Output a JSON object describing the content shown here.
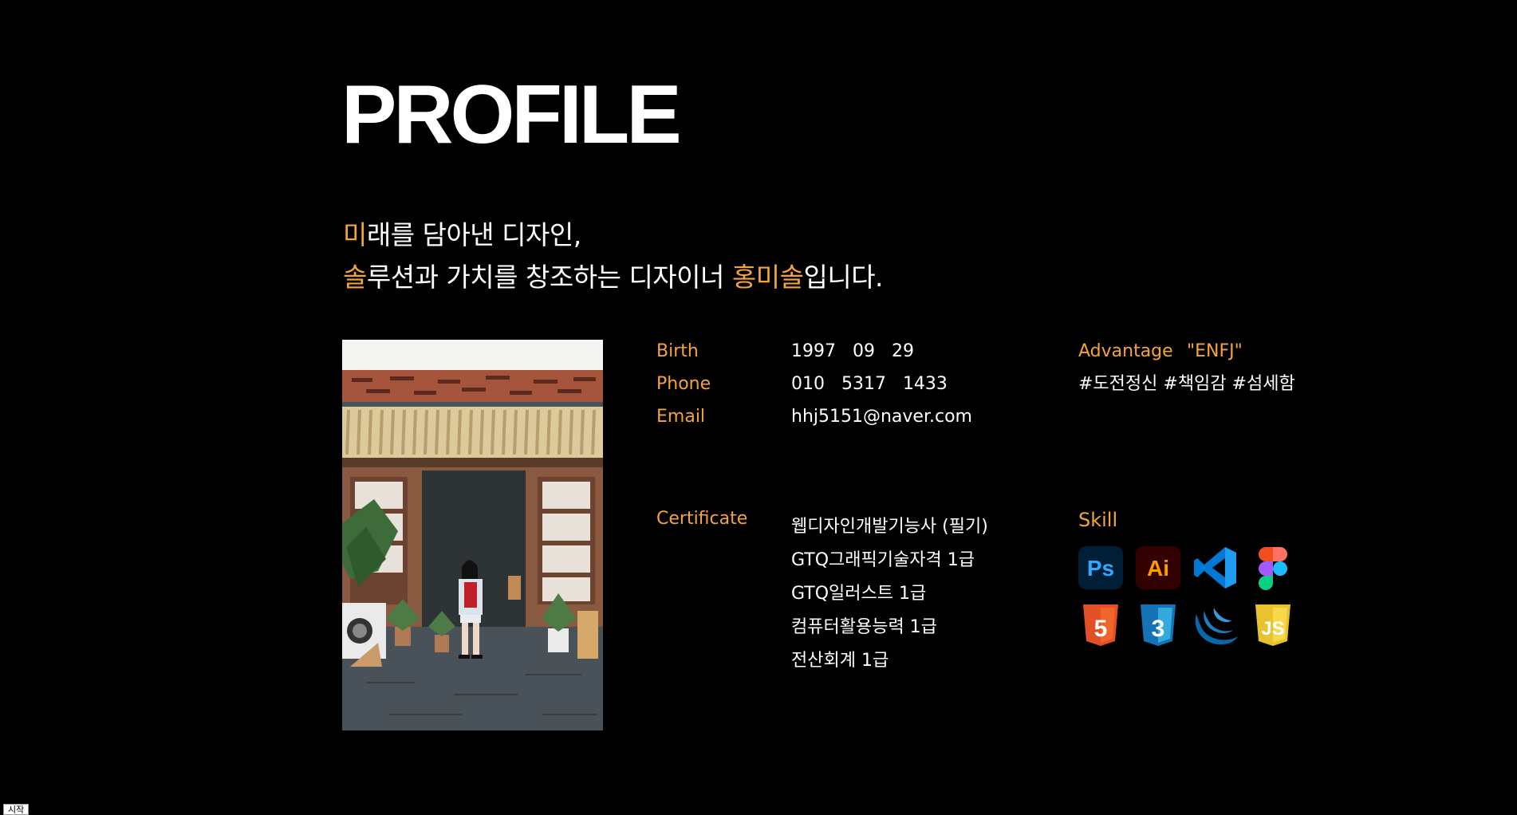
{
  "page": {
    "title": "PROFILE",
    "accent_color": "#f5a43c"
  },
  "intro": {
    "line1_accent": "미",
    "line1_rest": "래를 담아낸 디자인,",
    "line2_accent": "솔",
    "line2_mid": "루션과 가치를 창조하는 디자이너 ",
    "line2_name": "홍미솔",
    "line2_end": "입니다."
  },
  "info": {
    "birth_label": "Birth",
    "birth_value": "1997   09   29",
    "phone_label": "Phone",
    "phone_value": "010   5317   1433",
    "email_label": "Email",
    "email_value": "hhj5151@naver.com",
    "certificate_label": "Certificate"
  },
  "advantage": {
    "label": "Advantage",
    "mbti": "\"ENFJ\"",
    "tags": "#도전정신 #책임감 #섬세함"
  },
  "certificates": [
    "웹디자인개발기능사 (필기)",
    "GTQ그래픽기술자격 1급",
    "GTQ일러스트 1급",
    "컴퓨터활용능력 1급",
    "전산회계 1급"
  ],
  "skill": {
    "label": "Skill",
    "icons": [
      {
        "name": "photoshop-icon",
        "text": "Ps",
        "bg": "#001e36",
        "fg": "#31a8ff"
      },
      {
        "name": "illustrator-icon",
        "text": "Ai",
        "bg": "#330000",
        "fg": "#ff9a00"
      },
      {
        "name": "vscode-icon",
        "text": "",
        "bg": "",
        "fg": "#0078d4"
      },
      {
        "name": "figma-icon",
        "text": "",
        "bg": "",
        "fg": ""
      },
      {
        "name": "html5-icon",
        "text": "5",
        "bg": "#e34f26",
        "fg": "#ffffff"
      },
      {
        "name": "css3-icon",
        "text": "3",
        "bg": "#1572b6",
        "fg": "#ffffff"
      },
      {
        "name": "jquery-icon",
        "text": "",
        "bg": "",
        "fg": "#0769ad"
      },
      {
        "name": "javascript-icon",
        "text": "JS",
        "bg": "#f0c419",
        "fg": "#ffffff"
      }
    ]
  },
  "taskbar": {
    "start_label": "시작"
  }
}
